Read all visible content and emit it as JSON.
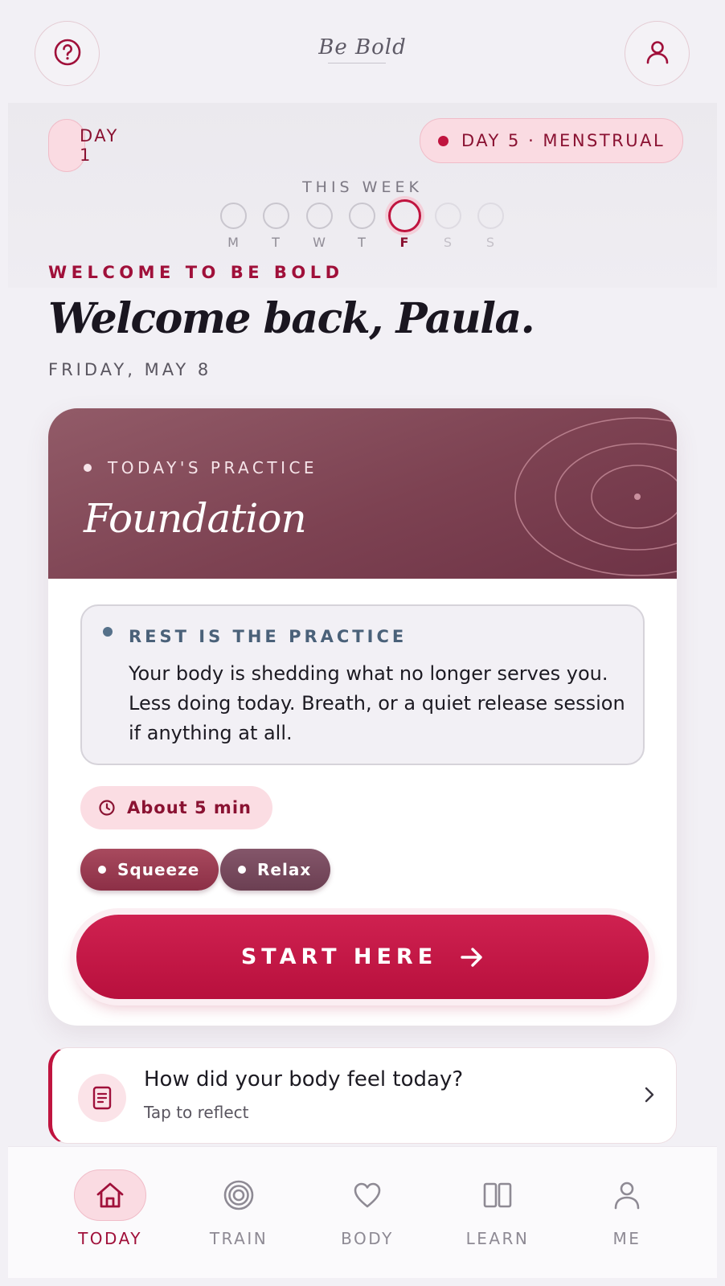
{
  "header": {
    "logo_text": "Be Bold",
    "help_icon": "help-circle-icon",
    "profile_icon": "user-icon"
  },
  "cycle": {
    "day_pill": "DAY 1",
    "cycle_pill": "DAY 5 · MENSTRUAL"
  },
  "week": {
    "label": "THIS WEEK",
    "days": [
      {
        "letter": "M",
        "state": "past"
      },
      {
        "letter": "T",
        "state": "past"
      },
      {
        "letter": "W",
        "state": "past"
      },
      {
        "letter": "T",
        "state": "past"
      },
      {
        "letter": "F",
        "state": "today"
      },
      {
        "letter": "S",
        "state": "future"
      },
      {
        "letter": "S",
        "state": "future"
      }
    ]
  },
  "welcome": {
    "eyebrow": "WELCOME TO BE BOLD",
    "greeting": "Welcome back, Paula.",
    "date": "FRIDAY, MAY 8"
  },
  "practice": {
    "eyebrow": "TODAY'S PRACTICE",
    "title": "Foundation",
    "note_title": "REST IS THE PRACTICE",
    "note_body": "Your body is shedding what no longer serves you. Less doing today. Breath, or a quiet release session if anything at all.",
    "duration": "About 5 min",
    "tags": [
      "Squeeze",
      "Relax"
    ],
    "start_label": "START HERE"
  },
  "reflect": {
    "title": "How did your body feel today?",
    "subtitle": "Tap to reflect"
  },
  "nav": {
    "items": [
      {
        "label": "TODAY",
        "icon": "home-icon",
        "active": true
      },
      {
        "label": "TRAIN",
        "icon": "target-icon",
        "active": false
      },
      {
        "label": "BODY",
        "icon": "heart-icon",
        "active": false
      },
      {
        "label": "LEARN",
        "icon": "book-icon",
        "active": false
      },
      {
        "label": "ME",
        "icon": "user-icon",
        "active": false
      }
    ]
  },
  "colors": {
    "accent": "#c0143f",
    "accent_dark": "#8a1232",
    "background": "#f2f0f5",
    "hero": "#7d4252",
    "note_title": "#4a6179"
  }
}
